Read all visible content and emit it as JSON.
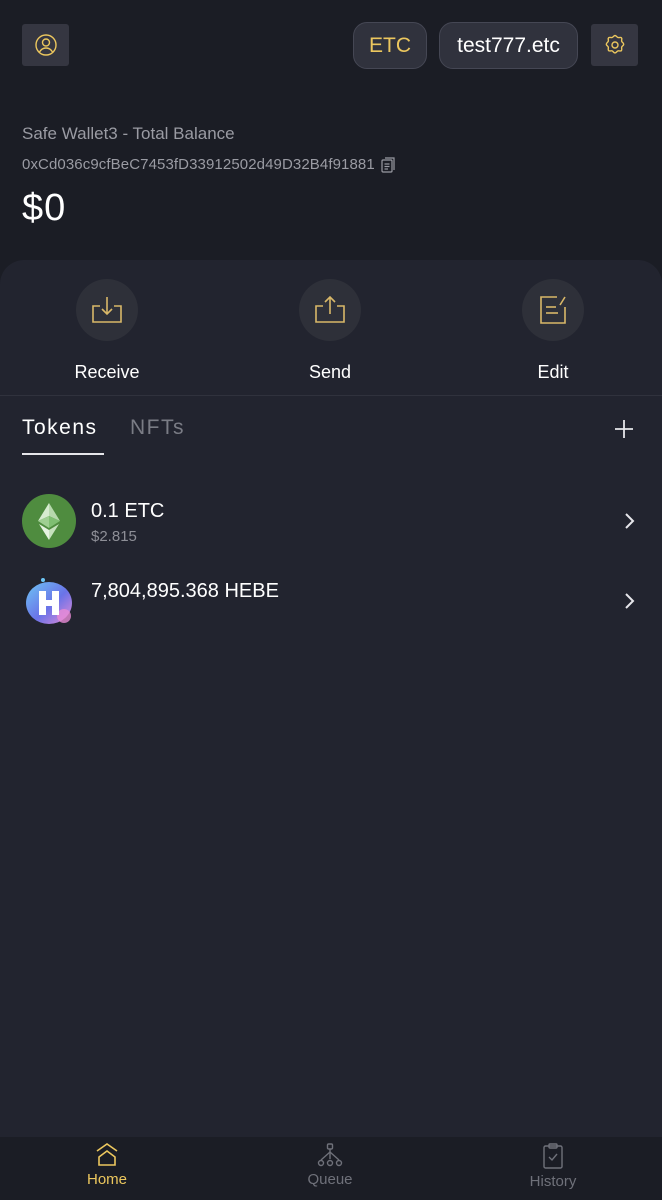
{
  "header": {
    "network_label": "ETC",
    "account_label": "test777.etc",
    "profile_icon": "user-circle-icon",
    "settings_icon": "gear-icon"
  },
  "balance": {
    "wallet_title": "Safe Wallet3 - Total Balance",
    "address": "0xCd036c9cfBeC7453fD33912502d49D32B4f91881",
    "copy_icon": "copy-icon",
    "total": "$0"
  },
  "actions": [
    {
      "label": "Receive",
      "icon": "download-tray-icon"
    },
    {
      "label": "Send",
      "icon": "upload-tray-icon"
    },
    {
      "label": "Edit",
      "icon": "edit-note-icon"
    }
  ],
  "tabs": {
    "items": [
      {
        "label": "Tokens",
        "active": true
      },
      {
        "label": "NFTs",
        "active": false
      }
    ],
    "add_icon": "plus-icon"
  },
  "tokens": [
    {
      "amount": "0.1 ETC",
      "fiat": "$2.815",
      "logo": "ethereum-classic-logo"
    },
    {
      "amount": "7,804,895.368 HEBE",
      "fiat": "",
      "logo": "hebe-logo"
    }
  ],
  "bottom_nav": [
    {
      "label": "Home",
      "icon": "home-icon",
      "active": true
    },
    {
      "label": "Queue",
      "icon": "queue-tree-icon",
      "active": false
    },
    {
      "label": "History",
      "icon": "clipboard-check-icon",
      "active": false
    }
  ],
  "colors": {
    "accent": "#ecc75e",
    "background": "#1b1d25",
    "card": "#22242f",
    "muted_text": "#9a9ba3",
    "etc_green": "#4f8c3f"
  }
}
